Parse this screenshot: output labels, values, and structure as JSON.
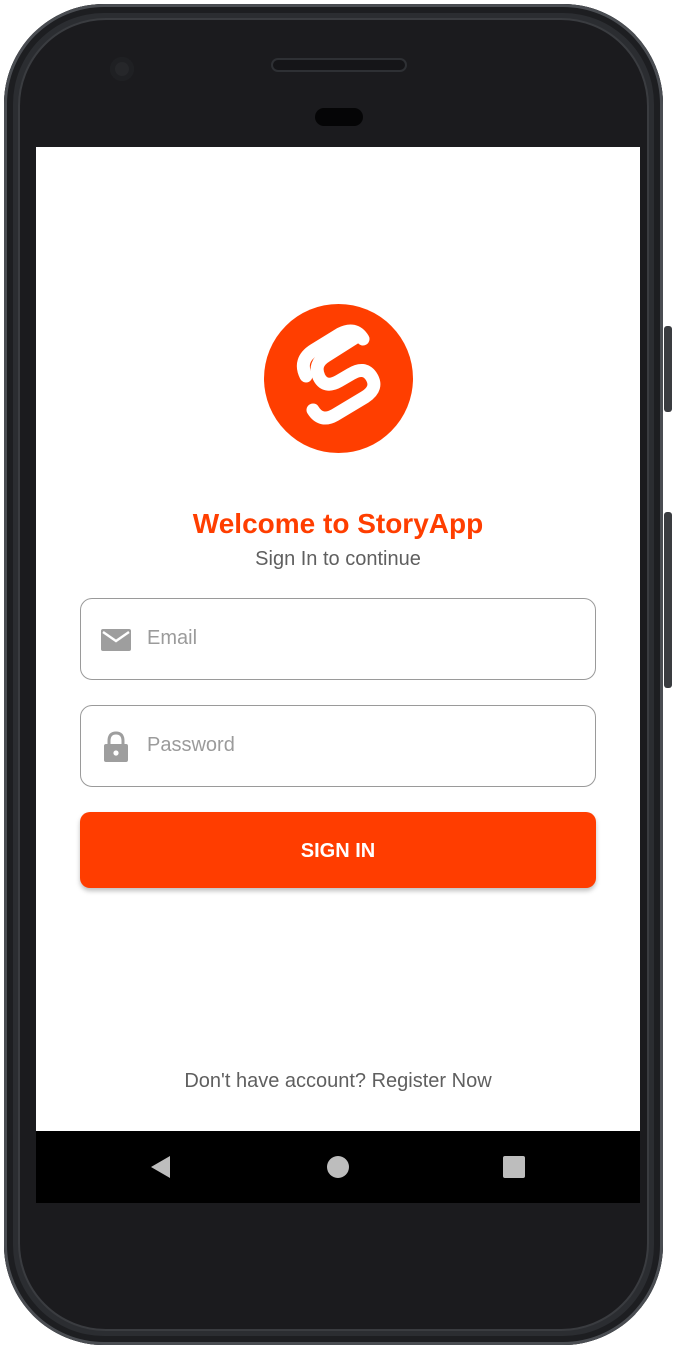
{
  "app": {
    "logo_icon": "svelte-logo-icon",
    "brand_color": "#ff3e00",
    "title": "Welcome to StoryApp",
    "subtitle": "Sign In to continue"
  },
  "form": {
    "email": {
      "placeholder": "Email",
      "value": "",
      "icon": "mail-icon"
    },
    "password": {
      "placeholder": "Password",
      "value": "",
      "icon": "lock-icon"
    },
    "submit_label": "SIGN IN"
  },
  "footer": {
    "register_text": "Don't have account? Register Now"
  },
  "system_nav": {
    "back": "back-triangle-icon",
    "home": "home-circle-icon",
    "recents": "recents-square-icon"
  }
}
